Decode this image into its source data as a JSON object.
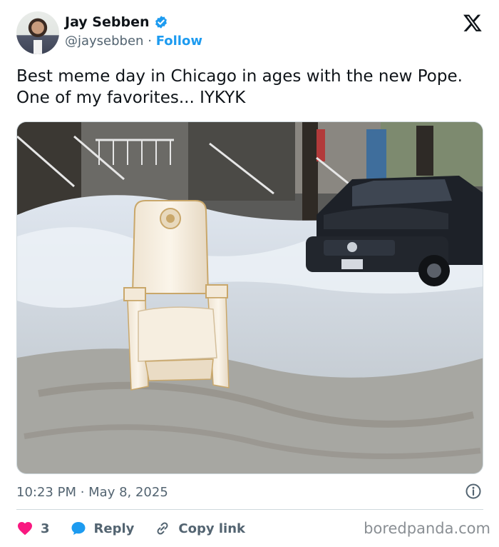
{
  "author": {
    "display_name": "Jay Sebben",
    "handle": "@jaysebben",
    "separator": "·",
    "follow_label": "Follow"
  },
  "tweet": {
    "text": "Best meme day in Chicago in ages with the new Pope. One of my favorites... IYKYK",
    "timestamp": "10:23 PM · May 8, 2025"
  },
  "media": {
    "description_icon": "photo"
  },
  "actions": {
    "like_count": "3",
    "reply_label": "Reply",
    "copy_link_label": "Copy link"
  },
  "watermark": "boredpanda.com",
  "colors": {
    "accent": "#1d9bf0",
    "like": "#f91880",
    "text": "#0f1419",
    "muted": "#536471"
  }
}
